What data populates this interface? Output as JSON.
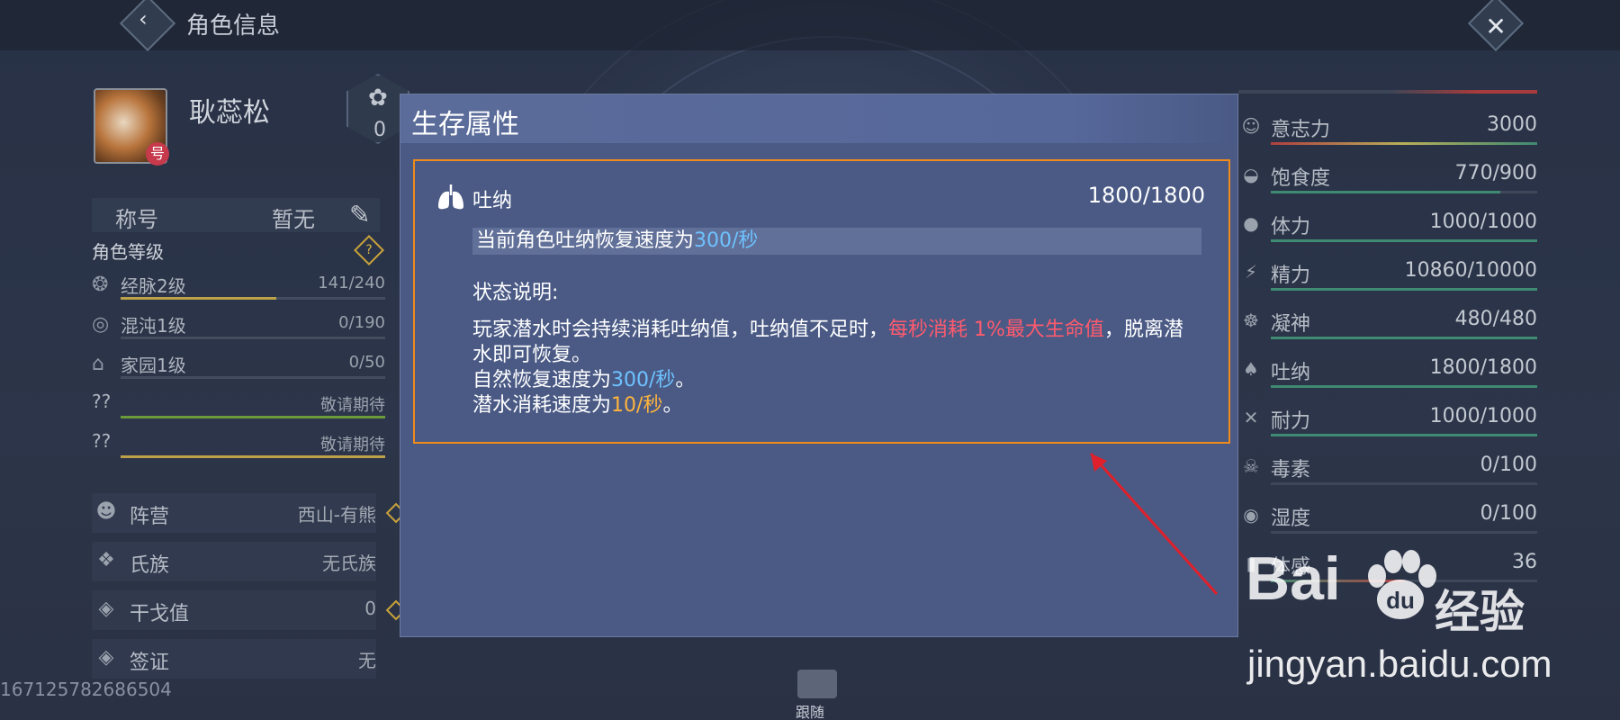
{
  "header": {
    "title": "角色信息",
    "back_icon": "‹",
    "close_icon": "✕"
  },
  "player": {
    "name": "耿蕊松",
    "badge": "号",
    "points": "0"
  },
  "title_row": {
    "label": "称号",
    "value": "暂无"
  },
  "level_section": {
    "heading": "角色等级"
  },
  "levels": [
    {
      "name": "经脉2级",
      "value": "141/240",
      "progress": 0.59
    },
    {
      "name": "混沌1级",
      "value": "0/190",
      "progress": 0
    },
    {
      "name": "家园1级",
      "value": "0/50",
      "progress": 0
    },
    {
      "name": "??",
      "value": "敬请期待",
      "progress": 1
    },
    {
      "name": "??",
      "value": "敬请期待",
      "progress": 1
    }
  ],
  "info": [
    {
      "name": "阵营",
      "value": "西山-有熊"
    },
    {
      "name": "氏族",
      "value": "无氏族"
    },
    {
      "name": "干戈值",
      "value": "0"
    },
    {
      "name": "签证",
      "value": "无"
    }
  ],
  "uid": "167125782686504",
  "stats": [
    {
      "name": "意志力",
      "value": "3000",
      "progress": 1,
      "color": "#b8b05a"
    },
    {
      "name": "饱食度",
      "value": "770/900",
      "progress": 0.86,
      "color": "#3f8a72"
    },
    {
      "name": "体力",
      "value": "1000/1000",
      "progress": 1,
      "color": "#3f8a72"
    },
    {
      "name": "精力",
      "value": "10860/10000",
      "progress": 1,
      "color": "#3f8a72"
    },
    {
      "name": "凝神",
      "value": "480/480",
      "progress": 1,
      "color": "#3f8a72"
    },
    {
      "name": "吐纳",
      "value": "1800/1800",
      "progress": 1,
      "color": "#3f8a72"
    },
    {
      "name": "耐力",
      "value": "1000/1000",
      "progress": 1,
      "color": "#3f8a72"
    },
    {
      "name": "毒素",
      "value": "0/100",
      "progress": 0,
      "color": "#3f8a72"
    },
    {
      "name": "湿度",
      "value": "0/100",
      "progress": 0,
      "color": "#3f8a72"
    },
    {
      "name": "体感",
      "value": "36",
      "progress": 0.5,
      "color": "#c0504a"
    }
  ],
  "modal": {
    "title": "生存属性",
    "attr_name": "吐纳",
    "attr_value": "1800/1800",
    "rate_prefix": "当前角色吐纳恢复速度为",
    "rate_value": "300/秒",
    "desc_heading": "状态说明:",
    "desc_part1": "玩家潜水时会持续消耗吐纳值，吐纳值不足时，",
    "desc_highlight": "每秒消耗 1%最大生命值",
    "desc_part2": "，脱离潜水即可恢复。",
    "natural_prefix": "自然恢复速度为",
    "natural_value": "300/秒",
    "natural_suffix": "。",
    "dive_prefix": "潜水消耗速度为",
    "dive_value": "10/秒",
    "dive_suffix": "。"
  },
  "watermark": {
    "logo": "Bai",
    "logo2": "经验",
    "url": "jingyan.baidu.com"
  },
  "follow": {
    "label": "跟随"
  }
}
